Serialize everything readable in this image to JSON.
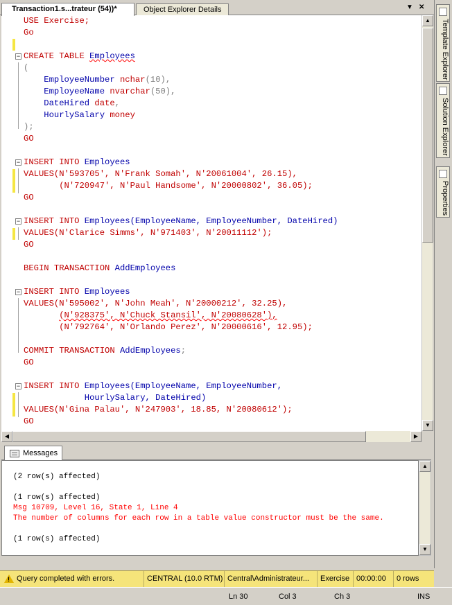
{
  "tabs": {
    "query_tab": "Transaction1.s...trateur (54))*",
    "details_tab": "Object Explorer Details",
    "dropdown_glyph": "▼",
    "close_glyph": "✕"
  },
  "sidebar": {
    "template_explorer": "Template Explorer",
    "solution_explorer": "Solution Explorer",
    "properties": "Properties"
  },
  "code": {
    "l1": "USE Exercise;",
    "l2": "Go",
    "l4_a": "CREATE TABLE ",
    "l4_b": "Employees",
    "l5": "(",
    "l6_a": "EmployeeNumber ",
    "l6_b": "nchar",
    "l6_c": "(10),",
    "l7_a": "EmployeeName ",
    "l7_b": "nvarchar",
    "l7_c": "(50),",
    "l8_a": "DateHired ",
    "l8_b": "date",
    "l8_c": ",",
    "l9_a": "HourlySalary ",
    "l9_b": "money",
    "l10": ");",
    "l11": "GO",
    "l13_a": "INSERT INTO ",
    "l13_b": "Employees",
    "l14_a": "VALUES",
    "l14_b": "(N'593705', N'Frank Somah', N'20061004', 26.15),",
    "l15": "(N'720947', N'Paul Handsome', N'20000802', 36.05);",
    "l16": "GO",
    "l18_a": "INSERT INTO ",
    "l18_b": "Employees",
    "l18_c": "(EmployeeName, EmployeeNumber, DateHired)",
    "l19_a": "VALUES",
    "l19_b": "(N'Clarice Simms', N'971403', N'20011112');",
    "l20": "GO",
    "l22_a": "BEGIN TRANSACTION ",
    "l22_b": "AddEmployees",
    "l24_a": "INSERT INTO ",
    "l24_b": "Employees",
    "l25_a": "VALUES",
    "l25_b": "(N'595002', N'John Meah', N'20000212', 32.25),",
    "l26": "(N'928375', N'Chuck Stansil', N'20080628'),",
    "l27": "(N'792764', N'Orlando Perez', N'20000616', 12.95);",
    "l29_a": "COMMIT TRANSACTION ",
    "l29_b": "AddEmployees",
    "l29_c": ";",
    "l30": "GO",
    "l32_a": "INSERT INTO ",
    "l32_b": "Employees",
    "l32_c": "(EmployeeName, EmployeeNumber,",
    "l33": "HourlySalary, DateHired)",
    "l34_a": "VALUES",
    "l34_b": "(N'Gina Palau', N'247903', 18.85, N'20080612');",
    "l35": "GO"
  },
  "results": {
    "tab_label": "Messages",
    "line1": "(2 row(s) affected)",
    "line2": "(1 row(s) affected)",
    "line3": "Msg 10709, Level 16, State 1, Line 4",
    "line4": "The number of columns for each row in a table value constructor must be the same.",
    "line5": "(1 row(s) affected)"
  },
  "status": {
    "message": "Query completed with errors.",
    "server": "CENTRAL (10.0 RTM)",
    "user": "Central\\Administrateur...",
    "database": "Exercise",
    "elapsed": "00:00:00",
    "rows": "0 rows"
  },
  "ide_status": {
    "ln": "Ln 30",
    "col": "Col 3",
    "ch": "Ch 3",
    "mode": "INS"
  },
  "colors": {
    "keyword": "#0000ff",
    "string": "#ff0000",
    "status_bg": "#f5e47a"
  }
}
